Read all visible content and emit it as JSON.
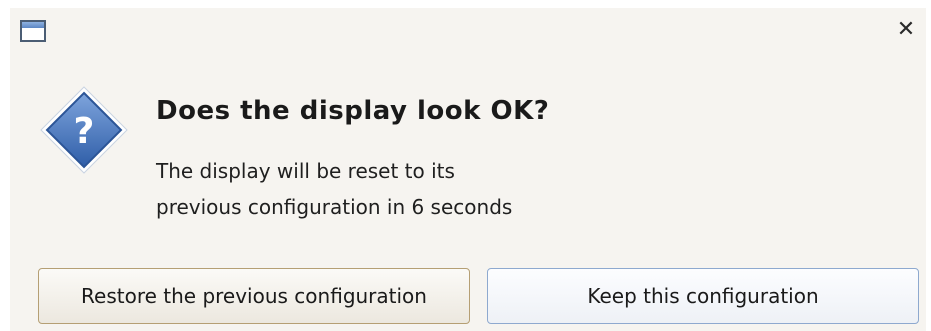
{
  "window": {
    "icon": "window-icon",
    "close_icon": "close-icon",
    "close_glyph": "✕"
  },
  "dialog": {
    "icon": "question-icon",
    "icon_glyph": "?",
    "heading": "Does the display look OK?",
    "message_line1": "The display will be reset to its",
    "message_line2": "previous configuration in 6 seconds"
  },
  "buttons": {
    "restore_label": "Restore the previous configuration",
    "keep_label": "Keep this configuration"
  },
  "colors": {
    "dialog_background": "#f6f4f0",
    "icon_blue": "#3f6fb8",
    "restore_border": "#b59f74",
    "keep_border": "#8ea9cf"
  }
}
